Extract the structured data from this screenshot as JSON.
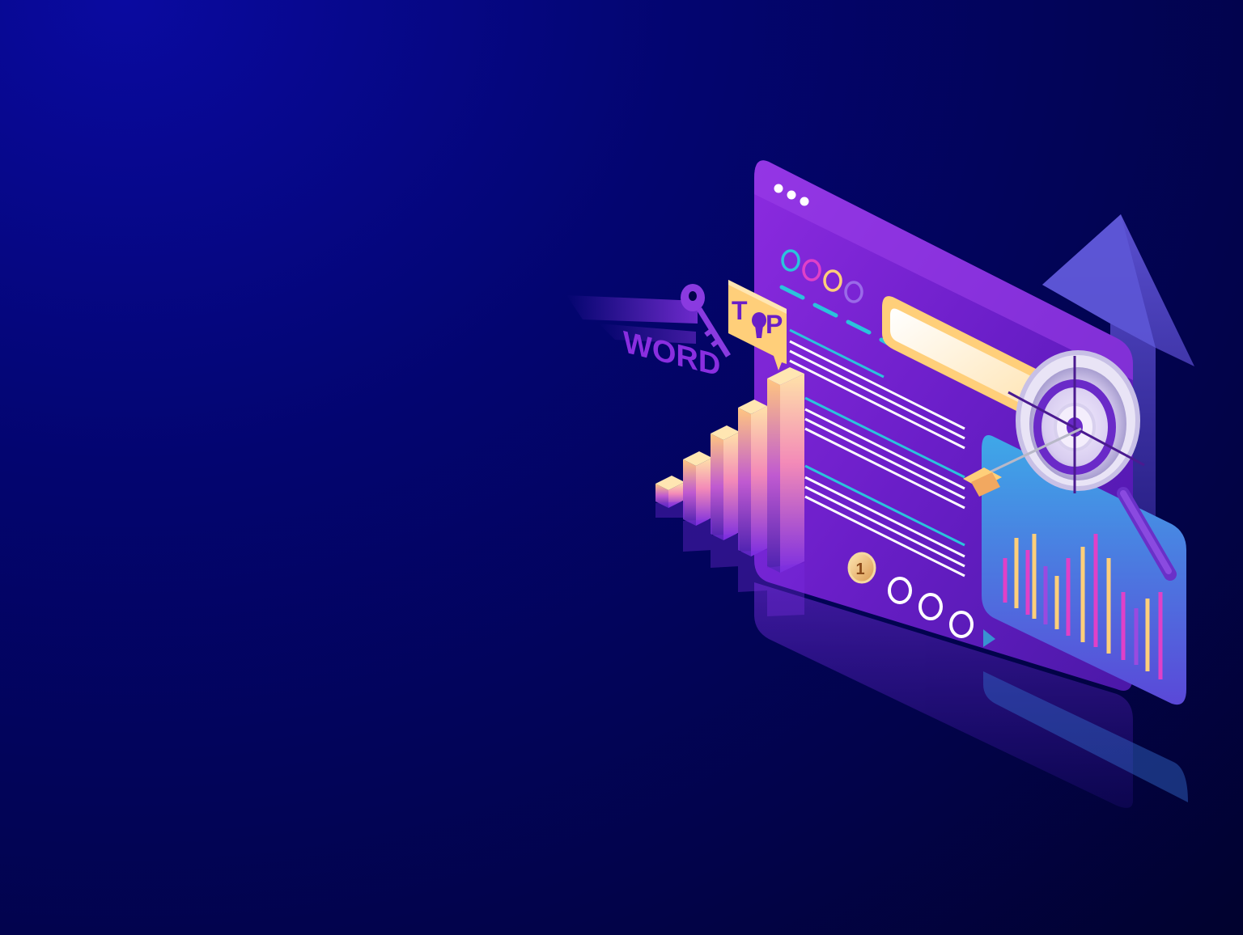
{
  "illustration": {
    "keyword_label": "WORD",
    "top_badge": {
      "letter_t": "T",
      "letter_p": "P"
    },
    "pagination": {
      "current_page": "1"
    },
    "colors": {
      "background": "#02034a",
      "panel": "#7b22d8",
      "accent_cyan": "#2bc3dc",
      "accent_gold": "#ffcf7a",
      "accent_pink": "#e040c8",
      "arrow": "#5a4ccc"
    },
    "icons": [
      "key-icon",
      "magnifier-icon",
      "target-icon",
      "arrow-up-icon",
      "bar-chart-icon"
    ]
  }
}
